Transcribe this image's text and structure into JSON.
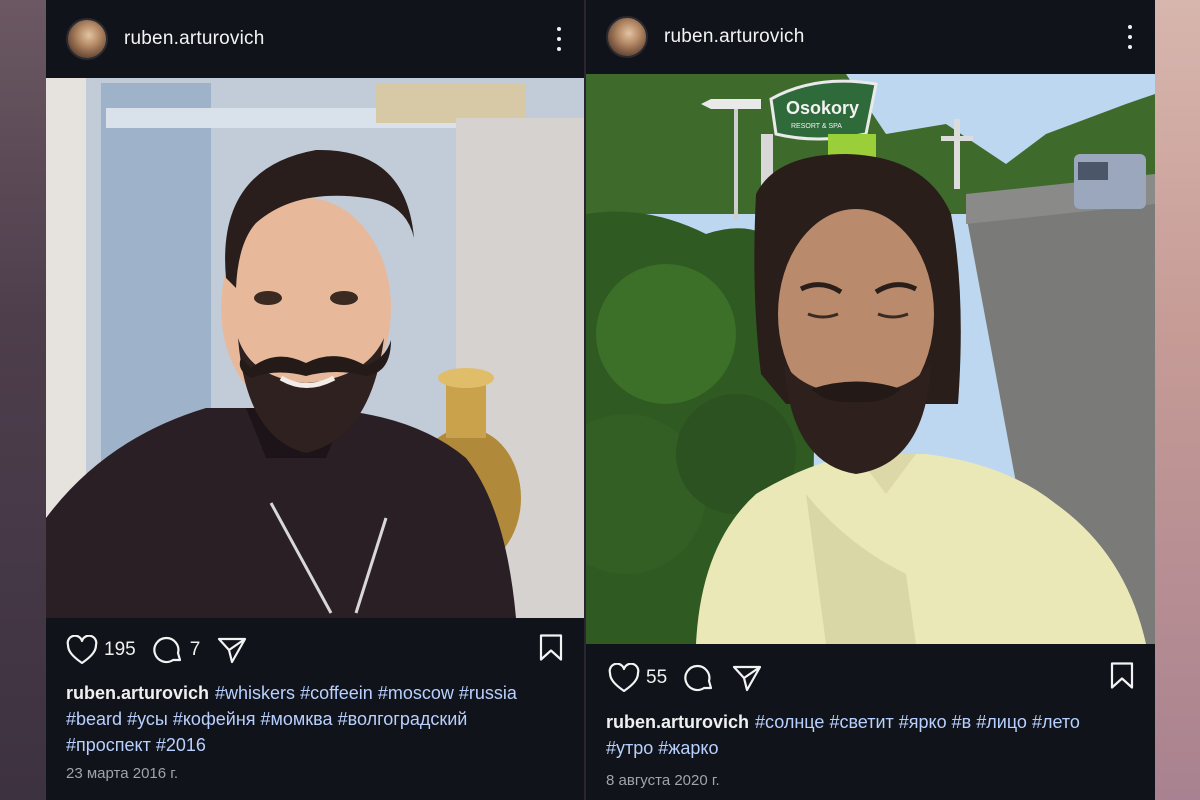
{
  "posts": [
    {
      "username": "ruben.arturovich",
      "likes": "195",
      "comments": "7",
      "caption_user": "ruben.arturovich",
      "hashtags": [
        "#whiskers",
        "#coffeein",
        "#moscow",
        "#russia",
        "#beard",
        "#усы",
        "#кофейня",
        "#момква",
        "#волгоградский",
        "#проспект",
        "#2016"
      ],
      "date": "23 марта 2016 г."
    },
    {
      "username": "ruben.arturovich",
      "likes": "55",
      "caption_user": "ruben.arturovich",
      "hashtags": [
        "#солнце",
        "#светит",
        "#ярко",
        "#в",
        "#лицо",
        "#лето",
        "#утро",
        "#жарко"
      ],
      "date": "8 августа 2020 г.",
      "sign_text": "Osokory",
      "sign_subtext": "RESORT & SPA"
    }
  ],
  "icons": {
    "like": "heart-icon",
    "comment": "comment-icon",
    "share": "share-icon",
    "save": "bookmark-icon",
    "more": "more-icon"
  },
  "colors": {
    "post_bg": "#10131a",
    "text": "#f3f3f3",
    "hashtag": "#b8d0ff",
    "date": "#a0a3ab"
  }
}
